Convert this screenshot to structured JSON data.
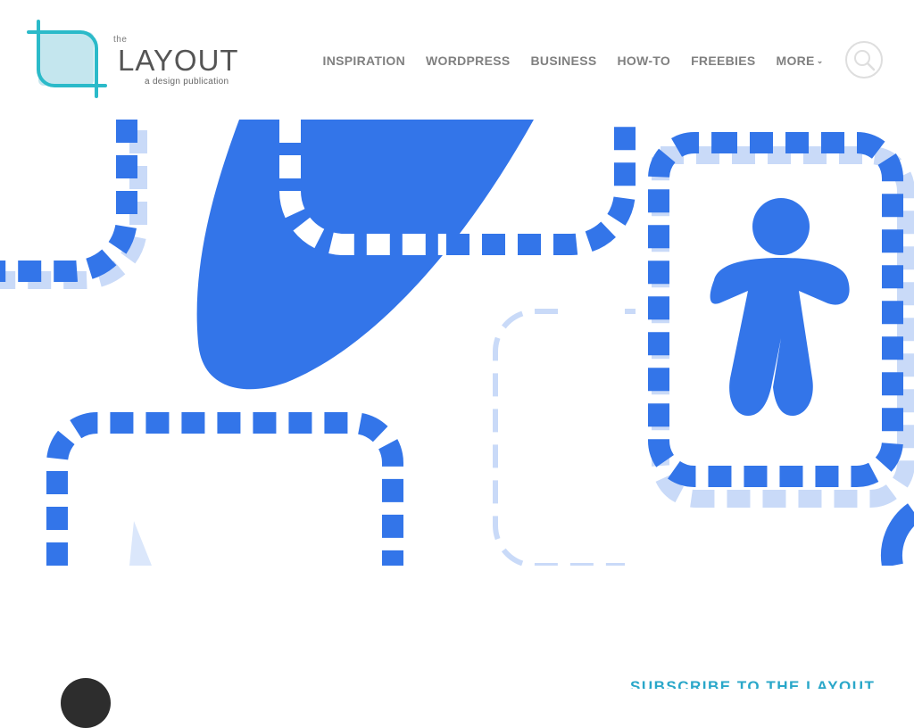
{
  "logo": {
    "the": "the",
    "name": "LAYOUT",
    "tagline": "a design publication",
    "accent_color": "#2bbac9",
    "fill_color": "#c4e6ee"
  },
  "nav": {
    "items": [
      {
        "label": "INSPIRATION"
      },
      {
        "label": "WORDPRESS"
      },
      {
        "label": "BUSINESS"
      },
      {
        "label": "HOW-TO"
      },
      {
        "label": "FREEBIES"
      },
      {
        "label": "MORE",
        "icon": "chevron-down-icon"
      }
    ],
    "search_icon": "search-icon"
  },
  "hero": {
    "illustration": "dashed-paths-with-person-icon",
    "primary_color": "#3375e9",
    "light_color": "#c9daf8"
  },
  "below": {
    "subscribe_heading": "SUBSCRIBE TO THE LAYOUT"
  }
}
